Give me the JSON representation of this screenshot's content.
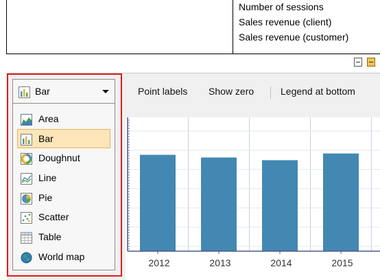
{
  "measures": {
    "items": [
      "Number of sessions",
      "Sales revenue (client)",
      "Sales revenue (customer)"
    ]
  },
  "chart_type": {
    "selected": "Bar",
    "options": [
      {
        "label": "Area",
        "icon": "area-chart-icon"
      },
      {
        "label": "Bar",
        "icon": "bar-chart-icon"
      },
      {
        "label": "Doughnut",
        "icon": "doughnut-chart-icon"
      },
      {
        "label": "Line",
        "icon": "line-chart-icon"
      },
      {
        "label": "Pie",
        "icon": "pie-chart-icon"
      },
      {
        "label": "Scatter",
        "icon": "scatter-chart-icon"
      },
      {
        "label": "Table",
        "icon": "table-icon"
      },
      {
        "label": "World map",
        "icon": "globe-icon"
      }
    ],
    "selected_index": 1
  },
  "chart_options": {
    "point_labels": "Point labels",
    "show_zero": "Show zero",
    "legend_at_bottom": "Legend at bottom"
  },
  "colors": {
    "bar": "#4388b3",
    "highlight_border": "#e11b1b",
    "selected_item": "#fce5b9",
    "active_button": "#f3c352"
  },
  "chart_data": {
    "type": "bar",
    "categories": [
      "2012",
      "2013",
      "2014",
      "2015"
    ],
    "values": [
      0.72,
      0.7,
      0.68,
      0.73
    ],
    "ylim": [
      0,
      1
    ],
    "y_tick_label": "€",
    "y_tick_count": 7,
    "grid": true,
    "xlabel": "",
    "ylabel": ""
  }
}
